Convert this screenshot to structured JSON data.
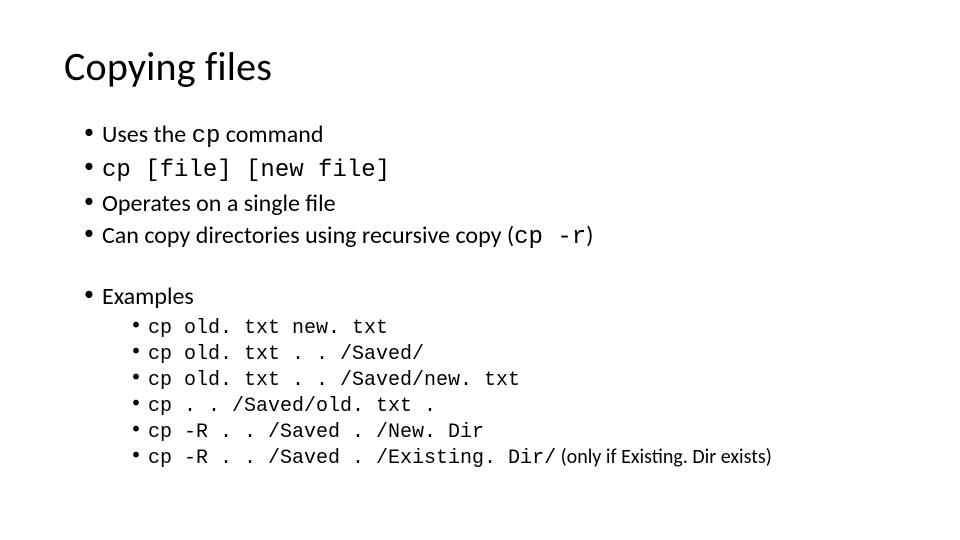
{
  "title": "Copying files",
  "bullets": {
    "b1_pre": "Uses the ",
    "b1_code": "cp",
    "b1_post": " command",
    "b2_code": "cp [file] [new file]",
    "b3": "Operates on a single file",
    "b4_pre": "Can copy directories using recursive copy (",
    "b4_code": "cp -r",
    "b4_post": ")"
  },
  "examples_label": "Examples",
  "examples": {
    "e1": "cp old. txt new. txt",
    "e2": "cp old. txt . . /Saved/",
    "e3": "cp old. txt . . /Saved/new. txt",
    "e4": "cp . . /Saved/old. txt .",
    "e5": "cp -R . . /Saved . /New. Dir",
    "e6_code": "cp -R . . /Saved . /Existing. Dir/",
    "e6_note": "  (only if Existing. Dir exists)"
  }
}
